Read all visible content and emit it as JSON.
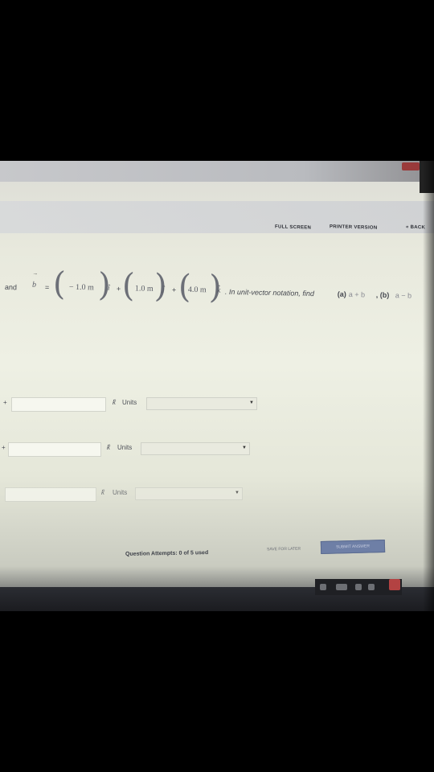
{
  "toolbar": {
    "full_screen": "FULL SCREEN",
    "printer_version": "PRINTER VERSION",
    "back": "« BACK"
  },
  "question": {
    "and": "and",
    "b_symbol": "b",
    "equals": "=",
    "c1": "− 1.0 m",
    "i_hat": "î",
    "plus1": "+",
    "c2": "1.0 m",
    "j_hat": "ĵ",
    "plus2": "+",
    "c3": "4.0 m",
    "k_hat": "k̂",
    "instruction": ". In unit-vector notation, find",
    "part_a_label": "(a)",
    "part_a_expr": "a + b",
    "part_b_label": ", (b)",
    "part_b_expr": "a − b"
  },
  "answers": [
    {
      "prefix": "+",
      "k_label": "k̂",
      "units_label": "Units",
      "selected_unit": ""
    },
    {
      "prefix": "+",
      "k_label": "k̂",
      "units_label": "Units",
      "selected_unit": ""
    },
    {
      "prefix": "",
      "k_label": "k̂",
      "units_label": "Units",
      "selected_unit": ""
    }
  ],
  "footer": {
    "attempts": "Question Attempts: 0 of 5 used",
    "save_for_later": "SAVE FOR LATER",
    "submit": "SUBMIT ANSWER"
  },
  "icons": {
    "dropdown": "chevron-down-icon"
  }
}
